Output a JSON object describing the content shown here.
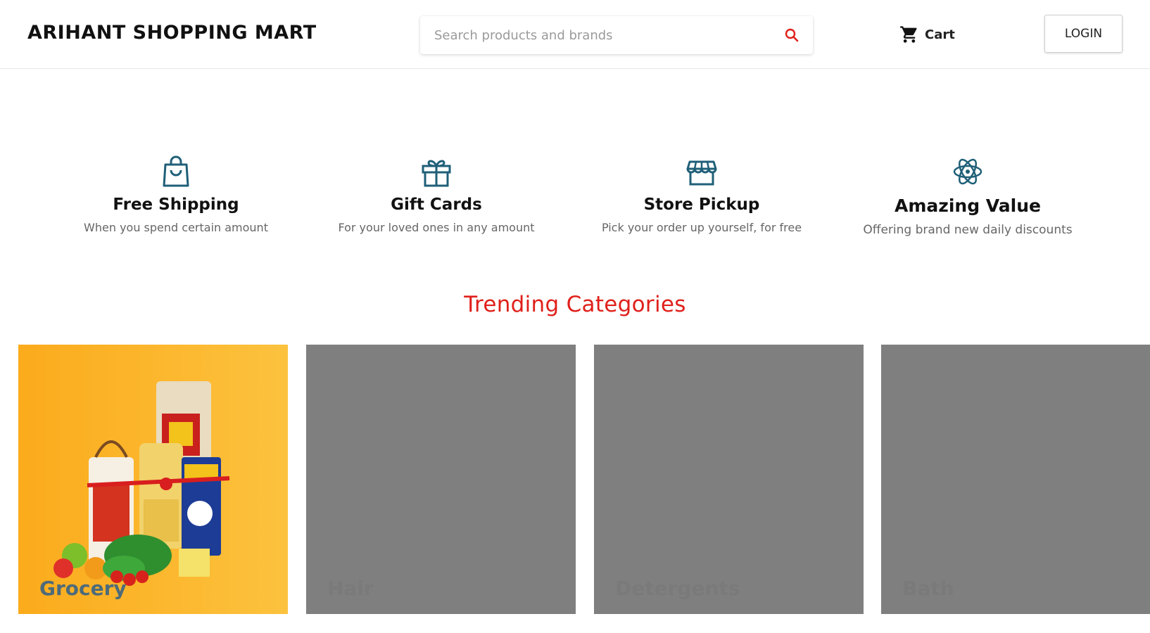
{
  "header": {
    "brand": "ARIHANT SHOPPING MART",
    "search_placeholder": "Search products and brands",
    "search_icon": "search-icon",
    "cart_label": "Cart",
    "login_label": "LOGIN"
  },
  "features": [
    {
      "icon": "shopping-bag-icon",
      "title": "Free Shipping",
      "desc": "When you spend certain amount"
    },
    {
      "icon": "gift-icon",
      "title": "Gift Cards",
      "desc": "For your loved ones in any amount"
    },
    {
      "icon": "store-icon",
      "title": "Store Pickup",
      "desc": "Pick your order up yourself, for free"
    },
    {
      "icon": "atom-icon",
      "title": "Amazing Value",
      "desc": "Offering brand new daily discounts"
    }
  ],
  "trending": {
    "title": "Trending Categories",
    "categories": [
      {
        "label": "Grocery"
      },
      {
        "label": "Hair"
      },
      {
        "label": "Detergents"
      },
      {
        "label": "Bath"
      }
    ]
  },
  "colors": {
    "accent_red": "#e0201b",
    "icon_teal": "#1f5f78",
    "placeholder_grey": "#7f7f7f",
    "grocery_bg": "#fbab1c"
  }
}
